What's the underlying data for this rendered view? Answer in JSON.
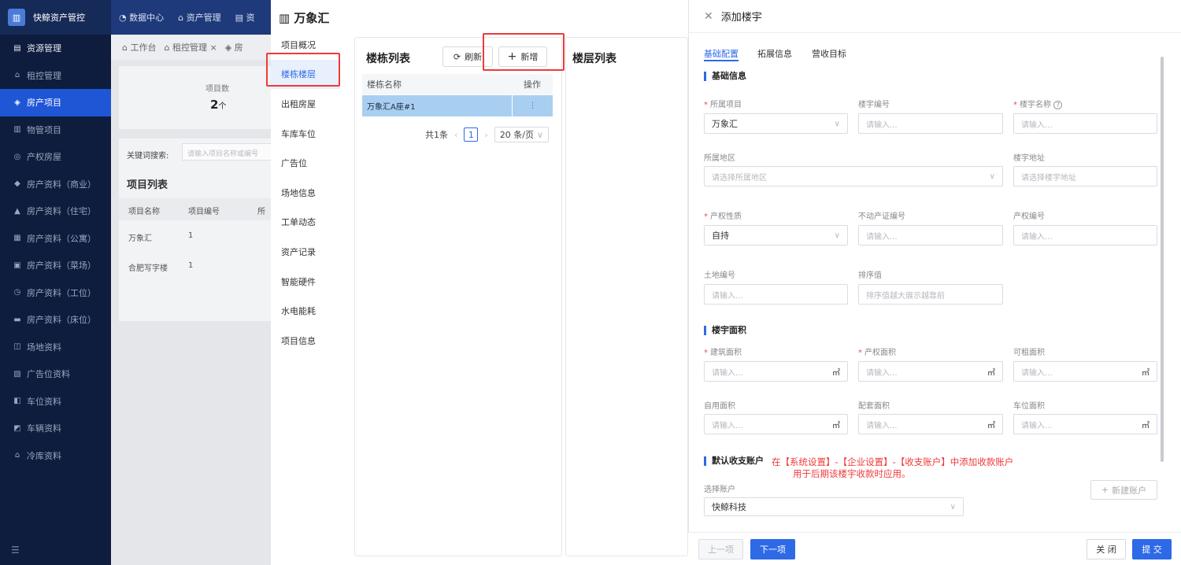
{
  "app": {
    "title": "快鲸资产管控",
    "logo_glyph": "▥"
  },
  "topnav": [
    "数据中心",
    "资产管理",
    "资"
  ],
  "sidebar": {
    "items": [
      {
        "label": "资源管理",
        "icon": "doc-icon",
        "type": "group"
      },
      {
        "label": "租控管理",
        "icon": "home-icon",
        "type": "item"
      },
      {
        "label": "房产项目",
        "icon": "layers-icon",
        "type": "active"
      },
      {
        "label": "物管项目",
        "icon": "building-icon",
        "type": "item"
      },
      {
        "label": "产权房屋",
        "icon": "stack-icon",
        "type": "item"
      },
      {
        "label": "房产资料（商业）",
        "icon": "store-icon",
        "type": "item"
      },
      {
        "label": "房产资料（住宅）",
        "icon": "house-icon",
        "type": "item"
      },
      {
        "label": "房产资料（公寓）",
        "icon": "apartment-icon",
        "type": "item"
      },
      {
        "label": "房产资料（菜场）",
        "icon": "market-icon",
        "type": "item"
      },
      {
        "label": "房产资料（工位）",
        "icon": "desk-icon",
        "type": "item"
      },
      {
        "label": "房产资料（床位）",
        "icon": "bed-icon",
        "type": "item"
      },
      {
        "label": "场地资料",
        "icon": "venue-icon",
        "type": "item"
      },
      {
        "label": "广告位资料",
        "icon": "ad-icon",
        "type": "item"
      },
      {
        "label": "车位资料",
        "icon": "parking-icon",
        "type": "item"
      },
      {
        "label": "车辆资料",
        "icon": "car-icon",
        "type": "item"
      },
      {
        "label": "冷库资料",
        "icon": "storage-icon",
        "type": "item"
      }
    ]
  },
  "tabs": [
    "工作台",
    "租控管理",
    "房"
  ],
  "stat": {
    "label": "项目数",
    "value": "2",
    "unit": "个"
  },
  "filter": {
    "label": "关键词搜索:",
    "placeholder": "请输入项目名称或编号"
  },
  "project_list": {
    "title": "项目列表",
    "columns": [
      "项目名称",
      "项目编号",
      "所"
    ],
    "rows": [
      [
        "万象汇",
        "1"
      ],
      [
        "合肥写字楼",
        "1"
      ]
    ]
  },
  "project": {
    "title": "万象汇",
    "nav": [
      "项目概况",
      "楼栋楼层",
      "出租房屋",
      "车库车位",
      "广告位",
      "场地信息",
      "工单动态",
      "资产记录",
      "智能硬件",
      "水电能耗",
      "项目信息"
    ],
    "active_nav": "楼栋楼层"
  },
  "buildings": {
    "title": "楼栋列表",
    "refresh_label": "刷新",
    "add_label": "新增",
    "col_name": "楼栋名称",
    "col_action": "操作",
    "row": {
      "name": "万象汇A座#1",
      "action": "⋮"
    },
    "pager": {
      "total": "共1条",
      "current": "1",
      "size": "20 条/页"
    }
  },
  "floors": {
    "title": "楼层列表"
  },
  "drawer": {
    "title": "添加楼宇",
    "tabs": [
      "基础配置",
      "拓展信息",
      "营收目标"
    ],
    "sections": {
      "basic": "基础信息",
      "area": "楼宇面积",
      "account": "默认收支账户"
    },
    "fields": {
      "project": {
        "label": "所属项目",
        "value": "万象汇"
      },
      "code": {
        "label": "楼宇编号",
        "placeholder": "请输入..."
      },
      "name": {
        "label": "楼宇名称",
        "placeholder": "请输入..."
      },
      "region": {
        "label": "所属地区",
        "placeholder": "请选择所属地区"
      },
      "address": {
        "label": "楼宇地址",
        "placeholder": "请选择楼宇地址"
      },
      "ownership": {
        "label": "产权性质",
        "value": "自持"
      },
      "cert": {
        "label": "不动产证编号",
        "placeholder": "请输入..."
      },
      "prop_no": {
        "label": "产权编号",
        "placeholder": "请输入..."
      },
      "land": {
        "label": "土地编号",
        "placeholder": "请输入..."
      },
      "sort": {
        "label": "排序值",
        "placeholder": "排序值越大展示越靠前"
      },
      "build_area": {
        "label": "建筑面积",
        "placeholder": "请输入..."
      },
      "prop_area": {
        "label": "产权面积",
        "placeholder": "请输入..."
      },
      "rent_area": {
        "label": "可租面积",
        "placeholder": "请输入..."
      },
      "self_area": {
        "label": "自用面积",
        "placeholder": "请输入..."
      },
      "support_area": {
        "label": "配套面积",
        "placeholder": "请输入..."
      },
      "parking_area": {
        "label": "车位面积",
        "placeholder": "请输入..."
      },
      "account_select": {
        "label": "选择账户",
        "value": "快鲸科技"
      }
    },
    "unit": "㎡",
    "hint_line1": "在【系统设置】-【企业设置】-【收支账户】中添加收款账户",
    "hint_line2": "用于后期该楼宇收款时应用。",
    "new_account": "新建账户",
    "buttons": {
      "prev": "上一项",
      "next": "下一项",
      "close": "关 闭",
      "submit": "提 交"
    }
  },
  "colors": {
    "accent": "#2e6ae6",
    "sidebar_bg": "#0e1c3d",
    "highlight": "#f03a3a",
    "selected_row": "#a9cff0"
  }
}
